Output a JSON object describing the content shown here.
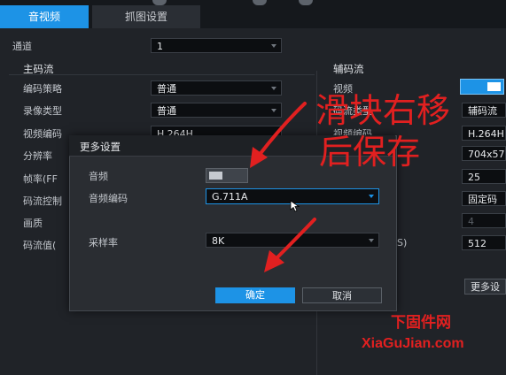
{
  "tabs": {
    "audio_video": "音视频",
    "capture_settings": "抓图设置"
  },
  "channel": {
    "label": "通道",
    "value": "1"
  },
  "main_stream": {
    "title": "主码流",
    "fields": [
      {
        "label": "编码策略",
        "value": "普通"
      },
      {
        "label": "录像类型",
        "value": "普通"
      },
      {
        "label": "视频编码",
        "value": "H.264H"
      },
      {
        "label": "分辨率",
        "value": ""
      },
      {
        "label": "帧率(FF",
        "value": ""
      },
      {
        "label": "码流控制",
        "value": ""
      },
      {
        "label": "画质",
        "value": ""
      },
      {
        "label": "码流值(",
        "value": ""
      }
    ]
  },
  "sub_stream": {
    "title": "辅码流",
    "video_label": "视频",
    "video_toggle_on": true,
    "fields": [
      {
        "label": "码流类型",
        "value": "辅码流"
      },
      {
        "label": "视频编码",
        "value": "H.264H"
      },
      {
        "label": "",
        "value": "704x57"
      },
      {
        "label": "",
        "value": "25"
      },
      {
        "label": "",
        "value": "固定码"
      },
      {
        "label": "",
        "value": "4"
      },
      {
        "label": "S)",
        "value": "512"
      }
    ],
    "more_button": "更多设"
  },
  "dialog": {
    "title": "更多设置",
    "audio_label": "音频",
    "audio_toggle_on": false,
    "audio_codec_label": "音频编码",
    "audio_codec_value": "G.711A",
    "sample_rate_label": "采样率",
    "sample_rate_value": "8K",
    "ok_label": "确定",
    "cancel_label": "取消"
  },
  "annotation": {
    "line1": "滑块右移",
    "line2": "后保存"
  },
  "watermark": {
    "cn": "下固件网",
    "en": "XiaGuJian.com"
  },
  "colors": {
    "accent": "#1d93e6",
    "annotation_red": "#e12020"
  }
}
